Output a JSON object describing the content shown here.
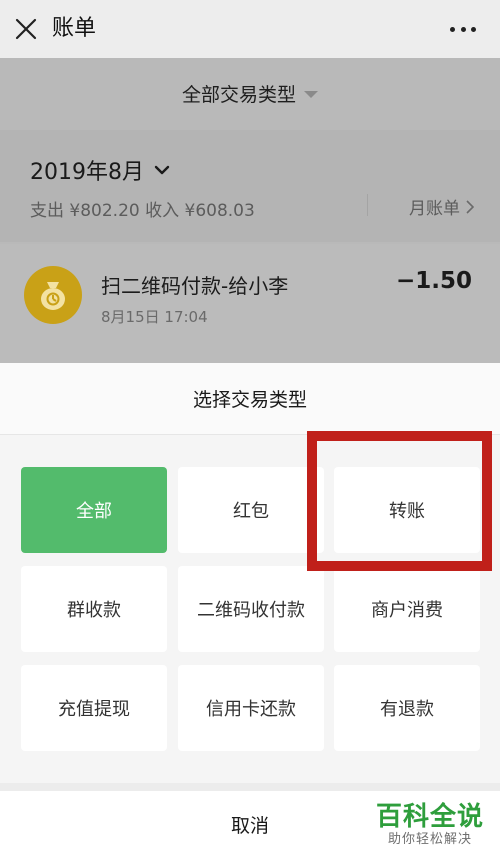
{
  "header": {
    "title": "账单"
  },
  "filter": {
    "label": "全部交易类型"
  },
  "month": {
    "title": "2019年8月",
    "summary": "支出 ¥802.20  收入 ¥608.03",
    "monthly_bill_label": "月账单"
  },
  "transaction": {
    "title": "扫二维码付款-给小李",
    "time": "8月15日 17:04",
    "amount": "−1.50"
  },
  "sheet": {
    "title": "选择交易类型",
    "options": [
      "全部",
      "红包",
      "转账",
      "群收款",
      "二维码收付款",
      "商户消费",
      "充值提现",
      "信用卡还款",
      "有退款"
    ],
    "selected_index": 0,
    "cancel_label": "取消"
  },
  "watermark": {
    "title": "百科全说",
    "subtitle": "助你轻松解决"
  },
  "colors": {
    "active_option": "#53bb6c",
    "highlight_box": "#c0201a",
    "avatar": "#c9a117"
  }
}
